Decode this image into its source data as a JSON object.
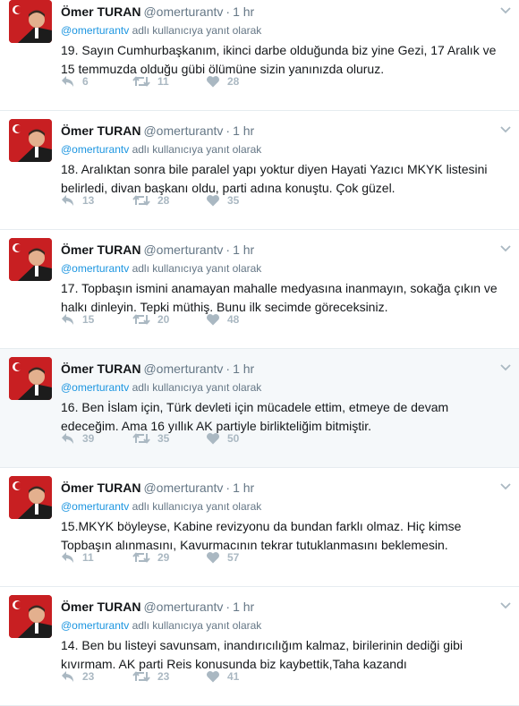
{
  "tweets": [
    {
      "author": "Ömer TURAN",
      "handle": "@omerturantv",
      "time": "1 hr",
      "context_mention": "@omerturantv",
      "context_suffix": "adlı kullanıcıya yanıt olarak",
      "line1": "19. Sayın Cumhurbaşkanım, ikinci darbe olduğunda biz yine Gezi, 17 Aralık ve",
      "line2": "15 temmuzda olduğu gübi ölümüne sizin yanınızda oluruz.",
      "replies": "6",
      "retweets": "11",
      "likes": "28",
      "highlight": false
    },
    {
      "author": "Ömer TURAN",
      "handle": "@omerturantv",
      "time": "1 hr",
      "context_mention": "@omerturantv",
      "context_suffix": "adlı kullanıcıya yanıt olarak",
      "line1": "18. Aralıktan sonra bile paralel yapı yoktur diyen Hayati Yazıcı MKYK listesini",
      "line2": "belirledi, divan başkanı oldu, parti adına konuştu. Çok güzel.",
      "replies": "13",
      "retweets": "28",
      "likes": "35",
      "highlight": false
    },
    {
      "author": "Ömer TURAN",
      "handle": "@omerturantv",
      "time": "1 hr",
      "context_mention": "@omerturantv",
      "context_suffix": "adlı kullanıcıya yanıt olarak",
      "line1": "17. Topbaşın ismini anamayan mahalle medyasına inanmayın, sokağa çıkın ve",
      "line2": "halkı dinleyin. Tepki müthiş. Bunu ilk secimde göreceksiniz.",
      "replies": "15",
      "retweets": "20",
      "likes": "48",
      "highlight": false
    },
    {
      "author": "Ömer TURAN",
      "handle": "@omerturantv",
      "time": "1 hr",
      "context_mention": "@omerturantv",
      "context_suffix": "adlı kullanıcıya yanıt olarak",
      "line1": "16. Ben İslam için, Türk devleti için mücadele ettim, etmeye de devam",
      "line2": "edeceğim. Ama 16 yıllık AK partiyle birlikteliğim bitmiştir.",
      "replies": "39",
      "retweets": "35",
      "likes": "50",
      "highlight": true
    },
    {
      "author": "Ömer TURAN",
      "handle": "@omerturantv",
      "time": "1 hr",
      "context_mention": "@omerturantv",
      "context_suffix": "adlı kullanıcıya yanıt olarak",
      "line1": "15.MKYK böyleyse, Kabine revizyonu da bundan farklı olmaz.  Hiç kimse",
      "line2": "Topbaşın alınmasını, Kavurmacının tekrar tutuklanmasını beklemesin.",
      "replies": "11",
      "retweets": "29",
      "likes": "57",
      "highlight": false
    },
    {
      "author": "Ömer TURAN",
      "handle": "@omerturantv",
      "time": "1 hr",
      "context_mention": "@omerturantv",
      "context_suffix": "adlı kullanıcıya yanıt olarak",
      "line1": "14. Ben bu listeyi savunsam, inandırıcılığım kalmaz, birilerinin dediği gibi",
      "line2": "kıvırmam. AK parti Reis konusunda biz kaybettik,Taha kazandı",
      "replies": "23",
      "retweets": "23",
      "likes": "41",
      "highlight": false
    }
  ],
  "colors": {
    "name": "#14171a",
    "meta": "#657786",
    "link": "#1b95e0",
    "action": "#aab8c2",
    "divider": "#e6ecf0",
    "highlight_bg": "#f5f8fa"
  },
  "icons": {
    "reply": "reply-icon",
    "retweet": "retweet-icon",
    "like": "heart-icon",
    "menu": "chevron-down-icon"
  }
}
